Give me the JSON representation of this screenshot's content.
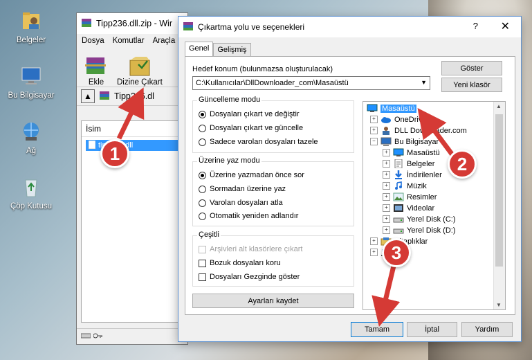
{
  "desktop": {
    "icons": [
      {
        "label": "Belgeler",
        "icon": "documents-folder-icon"
      },
      {
        "label": "Bu Bilgisayar",
        "icon": "computer-icon"
      },
      {
        "label": "Ağ",
        "icon": "network-icon"
      },
      {
        "label": "Çöp Kutusu",
        "icon": "recycle-bin-icon"
      }
    ]
  },
  "winrar": {
    "title": "Tipp236.dll.zip - Wir",
    "menu": [
      "Dosya",
      "Komutlar",
      "Araçla"
    ],
    "tools": {
      "add": "Ekle",
      "extract_to": "Dizine Çıkart"
    },
    "address": "Tipp236.dl",
    "column_name": "İsim",
    "file_row": "tipp236.dll"
  },
  "dialog": {
    "title": "Çıkartma yolu ve seçenekleri",
    "help": "?",
    "close": "✕",
    "tabs": [
      "Genel",
      "Gelişmiş"
    ],
    "destination_label": "Hedef konum (bulunmazsa oluşturulacak)",
    "destination_value": "C:\\Kullanıcılar\\DllDownloader_com\\Masaüstü",
    "show_button": "Göster",
    "new_folder_button": "Yeni klasör",
    "update_mode": {
      "title": "Güncelleme modu",
      "options": [
        "Dosyaları çıkart ve değiştir",
        "Dosyaları çıkart ve güncelle",
        "Sadece varolan dosyaları tazele"
      ],
      "selected": 0
    },
    "overwrite_mode": {
      "title": "Üzerine yaz modu",
      "options": [
        "Üzerine yazmadan önce sor",
        "Sormadan üzerine yaz",
        "Varolan dosyaları atla",
        "Otomatik yeniden adlandır"
      ],
      "selected": 0
    },
    "misc": {
      "title": "Çeşitli",
      "options": [
        "Arşivleri alt klasörlere çıkart",
        "Bozuk dosyaları koru",
        "Dosyaları Gezginde göster"
      ],
      "disabled": [
        true,
        false,
        false
      ]
    },
    "save_settings_button": "Ayarları kaydet",
    "tree": [
      {
        "label": "Masaüstü",
        "level": 0,
        "expander": "",
        "selected": true,
        "icon": "desktop-icon"
      },
      {
        "label": "OneDrive",
        "level": 1,
        "expander": "+",
        "icon": "cloud-icon"
      },
      {
        "label": "DLL Downloader.com",
        "level": 1,
        "expander": "+",
        "icon": "user-icon"
      },
      {
        "label": "Bu Bilgisayar",
        "level": 1,
        "expander": "−",
        "icon": "computer-icon"
      },
      {
        "label": "Masaüstü",
        "level": 2,
        "expander": "+",
        "icon": "desktop-icon"
      },
      {
        "label": "Belgeler",
        "level": 2,
        "expander": "+",
        "icon": "documents-icon"
      },
      {
        "label": "İndirilenler",
        "level": 2,
        "expander": "+",
        "icon": "download-icon"
      },
      {
        "label": "Müzik",
        "level": 2,
        "expander": "+",
        "icon": "music-icon"
      },
      {
        "label": "Resimler",
        "level": 2,
        "expander": "+",
        "icon": "pictures-icon"
      },
      {
        "label": "Videolar",
        "level": 2,
        "expander": "+",
        "icon": "videos-icon"
      },
      {
        "label": "Yerel Disk (C:)",
        "level": 2,
        "expander": "+",
        "icon": "disk-icon"
      },
      {
        "label": "Yerel Disk (D:)",
        "level": 2,
        "expander": "+",
        "icon": "disk-icon"
      },
      {
        "label": "Kitaplıklar",
        "level": 1,
        "expander": "+",
        "icon": "library-icon"
      },
      {
        "label": "Ağ",
        "level": 1,
        "expander": "+",
        "icon": "network-icon"
      }
    ],
    "ok_button": "Tamam",
    "cancel_button": "İptal",
    "help_button": "Yardım"
  },
  "annotations": {
    "color": "#d53a35",
    "steps": [
      "1",
      "2",
      "3"
    ]
  }
}
